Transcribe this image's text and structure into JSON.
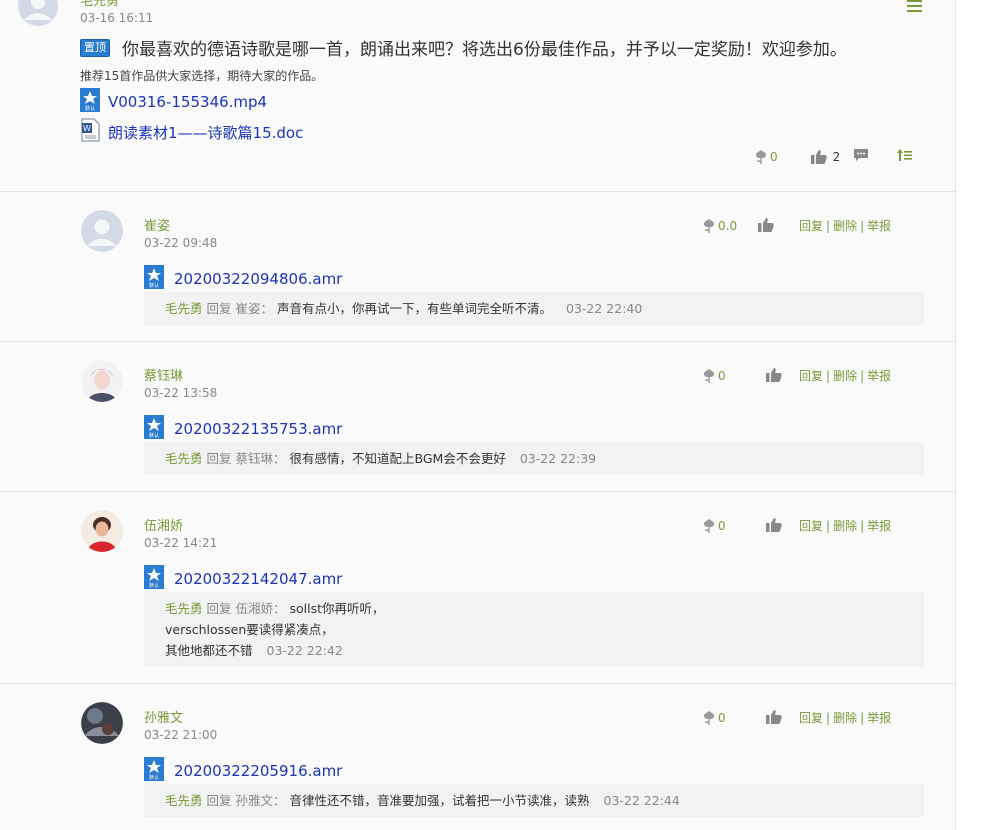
{
  "post": {
    "author": "毛先勇",
    "date": "03-16 16:11",
    "pin_label": "置顶",
    "title": "你最喜欢的德语诗歌是哪一首，朗诵出来吧？将选出6份最佳作品，并予以一定奖励！欢迎参加。",
    "subtitle": "推荐15首作品供大家选择，期待大家的作品。",
    "attachments": [
      {
        "name": "V00316-155346.mp4",
        "icon": "video-file-icon"
      },
      {
        "name": "朗读素材1——诗歌篇15.doc",
        "icon": "word-file-icon"
      }
    ],
    "flower_count": "0",
    "like_count": "2"
  },
  "comments": [
    {
      "name": "崔姿",
      "date": "03-22 09:48",
      "flower": "0.0",
      "attachment": "20200322094806.amr",
      "reply": {
        "who": "毛先勇",
        "label": "回复",
        "target": "崔姿：",
        "lines": [
          "声音有点小，你再试一下，有些单词完全听不清。"
        ],
        "time": "03-22 22:40"
      }
    },
    {
      "name": "蔡钰琳",
      "date": "03-22 13:58",
      "flower": "0",
      "attachment": "20200322135753.amr",
      "reply": {
        "who": "毛先勇",
        "label": "回复",
        "target": "蔡钰琳：",
        "lines": [
          "很有感情，不知道配上BGM会不会更好"
        ],
        "time": "03-22 22:39"
      }
    },
    {
      "name": "伍湘娇",
      "date": "03-22 14:21",
      "flower": "0",
      "attachment": "20200322142047.amr",
      "reply": {
        "who": "毛先勇",
        "label": "回复",
        "target": "伍湘娇：",
        "lines": [
          "sollst你再听听，",
          "verschlossen要读得紧凑点，",
          "其他地都还不错"
        ],
        "time": "03-22 22:42"
      }
    },
    {
      "name": "孙雅文",
      "date": "03-22 21:00",
      "flower": "0",
      "attachment": "20200322205916.amr",
      "reply": {
        "who": "毛先勇",
        "label": "回复",
        "target": "孙雅文：",
        "lines": [
          "音律性还不错，音准要加强，试着把一小节读准，读熟"
        ],
        "time": "03-22 22:44"
      }
    }
  ],
  "links": {
    "reply": "回复",
    "delete": "删除",
    "report": "举报",
    "sep": "|"
  },
  "attachment_badge": "默认",
  "colors": {
    "accent_green": "#7a9a3a",
    "link_blue": "#1a35b8",
    "badge_blue": "#2a7cd0"
  }
}
